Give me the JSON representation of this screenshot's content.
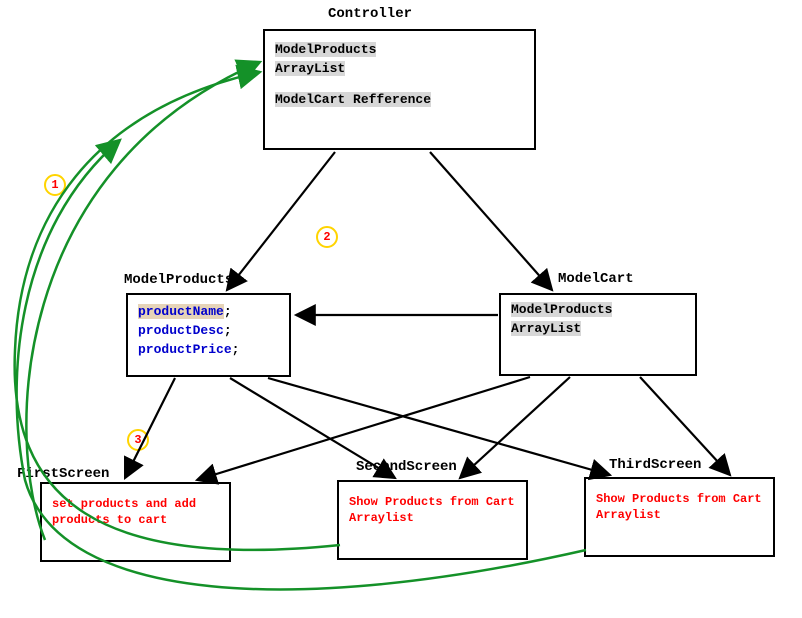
{
  "controller": {
    "title": "Controller",
    "line1": "ModelProducts",
    "line2": "ArrayList",
    "line3": "ModelCart Refference"
  },
  "modelProducts": {
    "title": "ModelProducts",
    "f1": "productName",
    "f2": "productDesc",
    "f3": "productPrice"
  },
  "modelCart": {
    "title": "ModelCart",
    "line1": "ModelProducts",
    "line2": "ArrayList"
  },
  "firstScreen": {
    "title": "FirstScreen",
    "text": "set products and add products to cart"
  },
  "secondScreen": {
    "title": "SecondScreen",
    "text": "Show Products from Cart Arraylist"
  },
  "thirdScreen": {
    "title": "ThirdScreen",
    "text": "Show Products from Cart Arraylist"
  },
  "badges": {
    "b1": "1",
    "b2": "2",
    "b3": "3"
  },
  "punct": {
    "semi": ";"
  }
}
